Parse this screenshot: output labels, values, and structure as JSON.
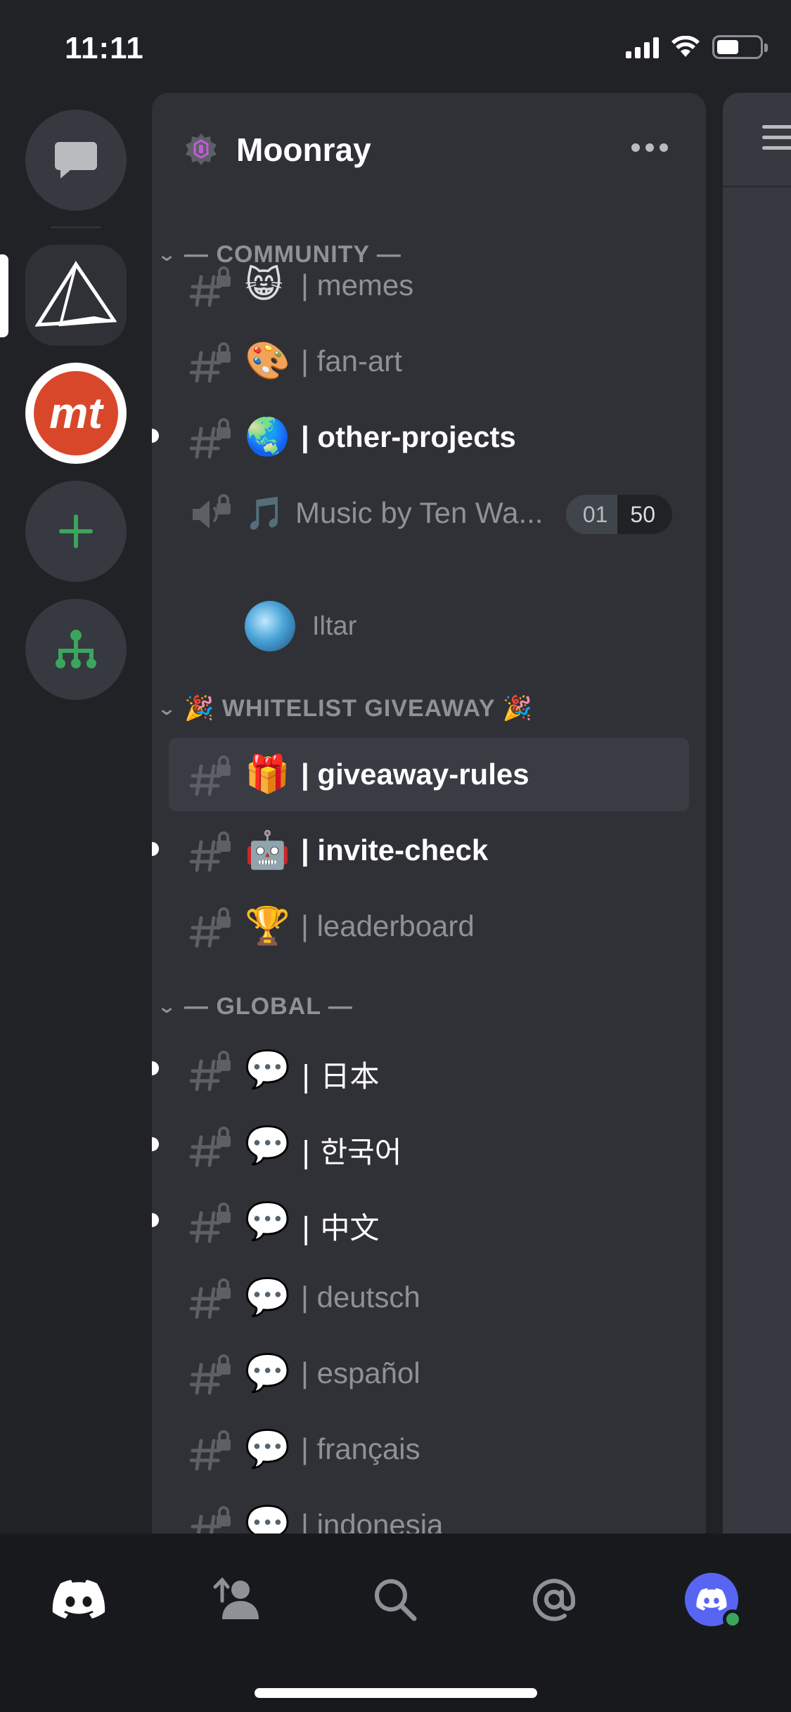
{
  "status_bar": {
    "time": "11:11"
  },
  "server": {
    "name": "Moonray"
  },
  "categories": {
    "community": "— COMMUNITY —",
    "whitelist": "🎉 WHITELIST GIVEAWAY 🎉",
    "global": "— GLOBAL —"
  },
  "channels": {
    "memes": {
      "emoji": "😸",
      "name": "| memes"
    },
    "fan_art": {
      "emoji": "🎨",
      "name": "| fan-art"
    },
    "other_projects": {
      "emoji": "🌏",
      "name": "| other-projects"
    },
    "music": {
      "emoji": "🎵",
      "name": "Music by Ten Wa..."
    },
    "giveaway_rules": {
      "emoji": "🎁",
      "name": "| giveaway-rules"
    },
    "invite_check": {
      "emoji": "🤖",
      "name": "| invite-check"
    },
    "leaderboard": {
      "emoji": "🏆",
      "name": "| leaderboard"
    },
    "japanese": {
      "emoji": "💬",
      "name": "| 日本"
    },
    "korean": {
      "emoji": "💬",
      "name": "| 한국어"
    },
    "chinese": {
      "emoji": "💬",
      "name": "| 中文"
    },
    "deutsch": {
      "emoji": "💬",
      "name": "| deutsch"
    },
    "espanol": {
      "emoji": "💬",
      "name": "| español"
    },
    "francais": {
      "emoji": "💬",
      "name": "| français"
    },
    "indonesia": {
      "emoji": "💬",
      "name": "| indonesia"
    }
  },
  "voice": {
    "current": "01",
    "max": "50",
    "user": "Iltar"
  },
  "colors": {
    "background": "#202225",
    "panel": "#2f3136",
    "selected": "#393c43",
    "accent_green": "#3ba55d",
    "blurple": "#5865f2",
    "muted_text": "#8e9297"
  },
  "icons": {
    "rail": [
      "direct-messages-icon",
      "pyramid-server-icon",
      "mt-server-icon",
      "add-server-icon",
      "explore-servers-icon"
    ],
    "tabs": [
      "discord-home-icon",
      "friends-icon",
      "search-icon",
      "mentions-icon",
      "profile-avatar"
    ]
  }
}
